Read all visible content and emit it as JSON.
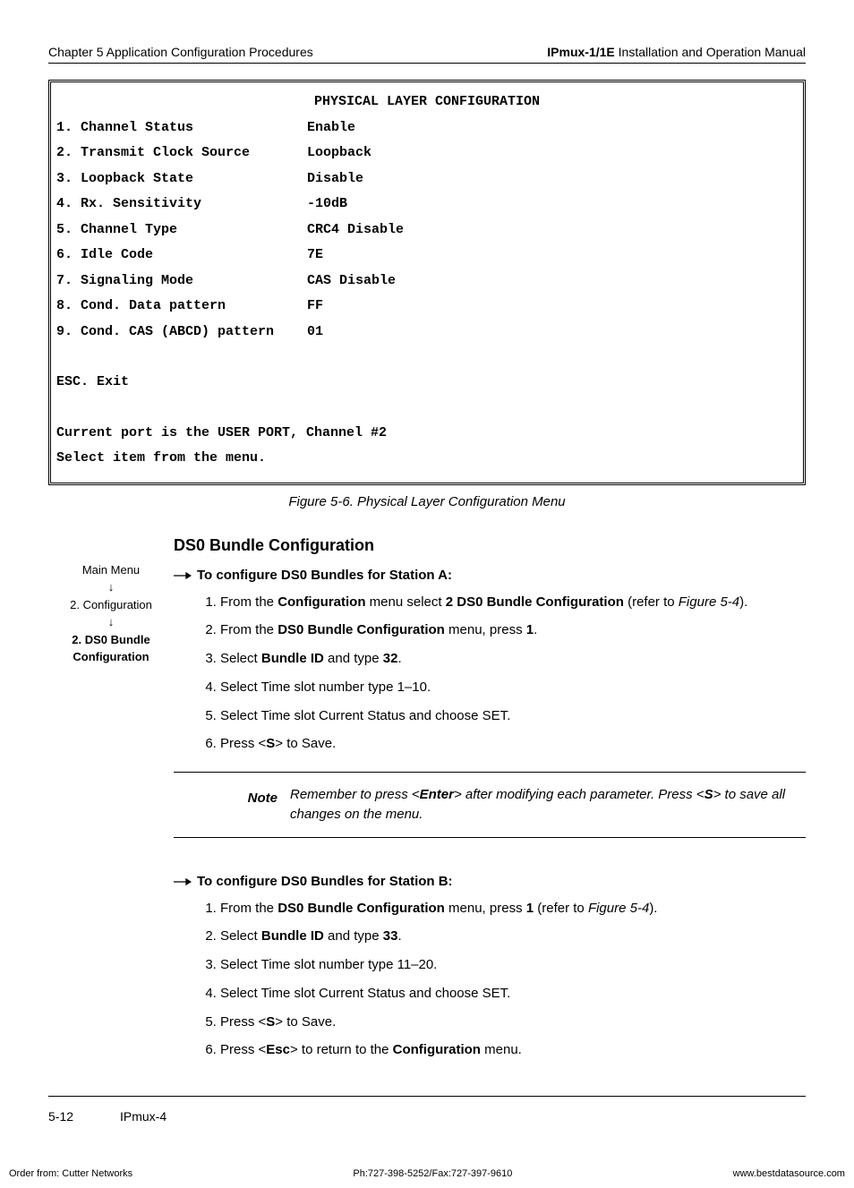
{
  "header": {
    "left": "Chapter 5  Application Configuration Procedures",
    "right_bold": "IPmux-1/1E",
    "right_rest": " Installation and Operation Manual"
  },
  "terminal": {
    "title": "PHYSICAL LAYER CONFIGURATION",
    "rows": [
      {
        "label": "1. Channel Status",
        "value": "Enable"
      },
      {
        "label": "2. Transmit Clock Source",
        "value": "Loopback"
      },
      {
        "label": "3. Loopback State",
        "value": "Disable"
      },
      {
        "label": "4. Rx. Sensitivity",
        "value": "-10dB"
      },
      {
        "label": "5. Channel Type",
        "value": "CRC4 Disable"
      },
      {
        "label": "6. Idle Code",
        "value": "7E"
      },
      {
        "label": "7. Signaling Mode",
        "value": "CAS Disable"
      },
      {
        "label": "8. Cond. Data pattern",
        "value": "FF"
      },
      {
        "label": "9. Cond. CAS (ABCD) pattern",
        "value": "01"
      }
    ],
    "esc": "ESC. Exit",
    "port_line": "Current port is the USER PORT, Channel #2",
    "select_line": "Select item from the menu."
  },
  "figure_caption": "Figure 5-6.  Physical Layer Configuration Menu",
  "nav": {
    "l1": "Main Menu",
    "down": "↓",
    "l2": "2. Configuration",
    "l3a": "2. DS0 Bundle",
    "l3b": "Configuration"
  },
  "section_title": "DS0 Bundle Configuration",
  "procA": {
    "title": "To configure DS0 Bundles for Station A:",
    "s1_a": "From the ",
    "s1_b": "Configuration",
    "s1_c": " menu select ",
    "s1_d": "2 DS0 Bundle Configuration",
    "s1_e": " (refer to ",
    "s1_f": "Figure 5-4",
    "s1_g": ").",
    "s2_a": "From the ",
    "s2_b": "DS0 Bundle Configuration",
    "s2_c": " menu, press ",
    "s2_d": "1",
    "s2_e": ".",
    "s3_a": "Select ",
    "s3_b": "Bundle ID",
    "s3_c": " and type ",
    "s3_d": "32",
    "s3_e": ".",
    "s4": "Select Time slot number type 1–10.",
    "s5": "Select Time slot Current Status and choose SET.",
    "s6_a": "Press <",
    "s6_b": "S",
    "s6_c": "> to Save."
  },
  "note": {
    "label": "Note",
    "t1": "Remember to press <",
    "t2": "Enter",
    "t3": "> after modifying each parameter. Press <",
    "t4": "S",
    "t5": "> to save all changes on the menu."
  },
  "procB": {
    "title": "To configure DS0 Bundles for Station B:",
    "s1_a": "From the ",
    "s1_b": "DS0 Bundle Configuration",
    "s1_c": " menu, press ",
    "s1_d": "1",
    "s1_e": " (refer to ",
    "s1_f": "Figure 5-4",
    "s1_g": ").",
    "s2_a": "Select ",
    "s2_b": "Bundle ID",
    "s2_c": " and type ",
    "s2_d": "33",
    "s2_e": ".",
    "s3": "Select Time slot number type 11–20.",
    "s4": "Select Time slot Current Status and choose SET.",
    "s5_a": "Press <",
    "s5_b": "S",
    "s5_c": "> to Save.",
    "s6_a": "Press <",
    "s6_b": "Esc",
    "s6_c": "> to return to the ",
    "s6_d": "Configuration",
    "s6_e": " menu."
  },
  "bottom": {
    "page": "5-12",
    "product": "IPmux-4"
  },
  "footer": {
    "left": "Order from: Cutter Networks",
    "center": "Ph:727-398-5252/Fax:727-397-9610",
    "right": "www.bestdatasource.com"
  }
}
